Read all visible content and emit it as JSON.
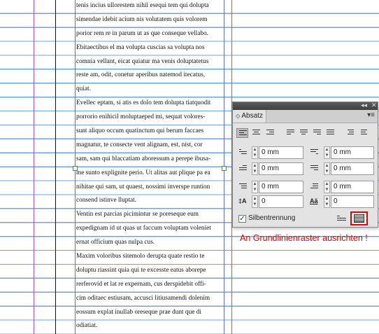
{
  "document": {
    "lines": [
      "tenis incius ullorestem nihil esequi tem qui dolupta",
      "simendae idebit acium nis volutatem quis volorem",
      "porior rem re in parum ut as que conseque vellabo.",
      "Ebitaectibus el ma volupta cuscias sa volupta nos",
      "comnia vellant, eicat quiatur ma venis doluptatetus",
      "reste am, odit, conetur aperibus natemod itecatus,",
      "quiat.",
      "Evellec eptam, si atis es dolo tem dolupta tiatquodit",
      "porrorio enihicil moluptaeped mi, sequat volores-",
      "sunt aliquo occum quatinctum qui berum faccaes",
      "magnatur, te consecte vent alignam, est, nist, cor",
      "sam, sam qui blaccatiam aboressum a perepe ibusa-",
      "me sunto explignite perio. Ut alitas aut plique pa ea",
      "nihitae qui sam, ut quaest, nossimi inverspe runtion",
      "consend istinve lluptat.",
      "Ventin est parcias picimintur se poreseque eum",
      "expedignam id ut quas ut faccum voluptam voleniet",
      "ernat officium quas nulpa cus.",
      "Maxim voloribus sitemolo derupta quate restio te",
      "doluptu riassint quia qui te excesste eatus aborepe",
      "rerferovid et lat re expernam, cus derspidebit offi-",
      "cim oditaec estiusam, accusci litiusamendi dolenim",
      "eossum explat inullab oreseque prae dunt que di",
      "odiatiat."
    ]
  },
  "panel": {
    "title": "Absatz",
    "collapse_glyph": "◂◂",
    "close_glyph": "✕",
    "menu_glyph": "▾≡",
    "left_indent": "0 mm",
    "right_indent": "0 mm",
    "first_line_indent": "0 mm",
    "last_line_indent": "0 mm",
    "space_before": "0 mm",
    "space_after": "0 mm",
    "dropcap_lines": "0",
    "dropcap_chars": "0",
    "hyphenation_label": "Silbentrennung",
    "hyphenation_checked": true
  },
  "annotation": "An Grundlinienraster  ausrichten !",
  "colors": {
    "baseline_grid": "#6fa6d8",
    "margin_guide": "#a24fd4",
    "column_guide": "#5f6de0",
    "annotation": "#e00000"
  }
}
